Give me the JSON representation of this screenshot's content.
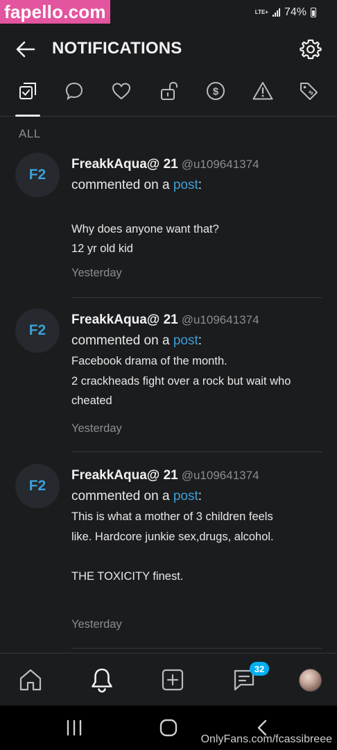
{
  "status_bar": {
    "watermark": "fapello.com",
    "network": "LTE+",
    "battery_percent": "74%"
  },
  "header": {
    "title": "NOTIFICATIONS"
  },
  "tabs": [
    {
      "icon": "checklist-icon",
      "active": true
    },
    {
      "icon": "comment-icon",
      "active": false
    },
    {
      "icon": "heart-icon",
      "active": false
    },
    {
      "icon": "unlock-icon",
      "active": false
    },
    {
      "icon": "dollar-icon",
      "active": false
    },
    {
      "icon": "warning-icon",
      "active": false
    },
    {
      "icon": "tag-icon",
      "active": false
    }
  ],
  "filter_label": "ALL",
  "notifications": [
    {
      "avatar_initials": "F2",
      "name": "FreakkAqua@ 21",
      "handle": "@u109641374",
      "action_prefix": "commented on a ",
      "action_link": "post",
      "action_suffix": ":",
      "comment_lines": [
        "",
        "Why does anyone want that?",
        "12 yr old kid"
      ],
      "timestamp": "Yesterday"
    },
    {
      "avatar_initials": "F2",
      "name": "FreakkAqua@ 21",
      "handle": "@u109641374",
      "action_prefix": "commented on a ",
      "action_link": "post",
      "action_suffix": ":",
      "comment_lines": [
        "Facebook drama of the month.",
        "2 crackheads fight over a rock but wait who",
        "cheated"
      ],
      "timestamp": "Yesterday"
    },
    {
      "avatar_initials": "F2",
      "name": "FreakkAqua@ 21",
      "handle": "@u109641374",
      "action_prefix": "commented on a ",
      "action_link": "post",
      "action_suffix": ":",
      "comment_lines": [
        "This is what a mother of 3 children feels",
        "like. Hardcore junkie sex,drugs, alcohol.",
        "",
        "THE TOXICITY finest."
      ],
      "timestamp": "Yesterday"
    }
  ],
  "bottom_nav": {
    "items": [
      "home-icon",
      "bell-icon",
      "add-post-icon",
      "messages-icon",
      "profile-avatar"
    ],
    "messages_badge": "32"
  },
  "watermark_bottom": "OnlyFans.com/fcassibreee",
  "colors": {
    "background": "#1b1c1e",
    "accent": "#00aff0",
    "link": "#3d9fd8",
    "watermark_pink": "#e3559e"
  }
}
